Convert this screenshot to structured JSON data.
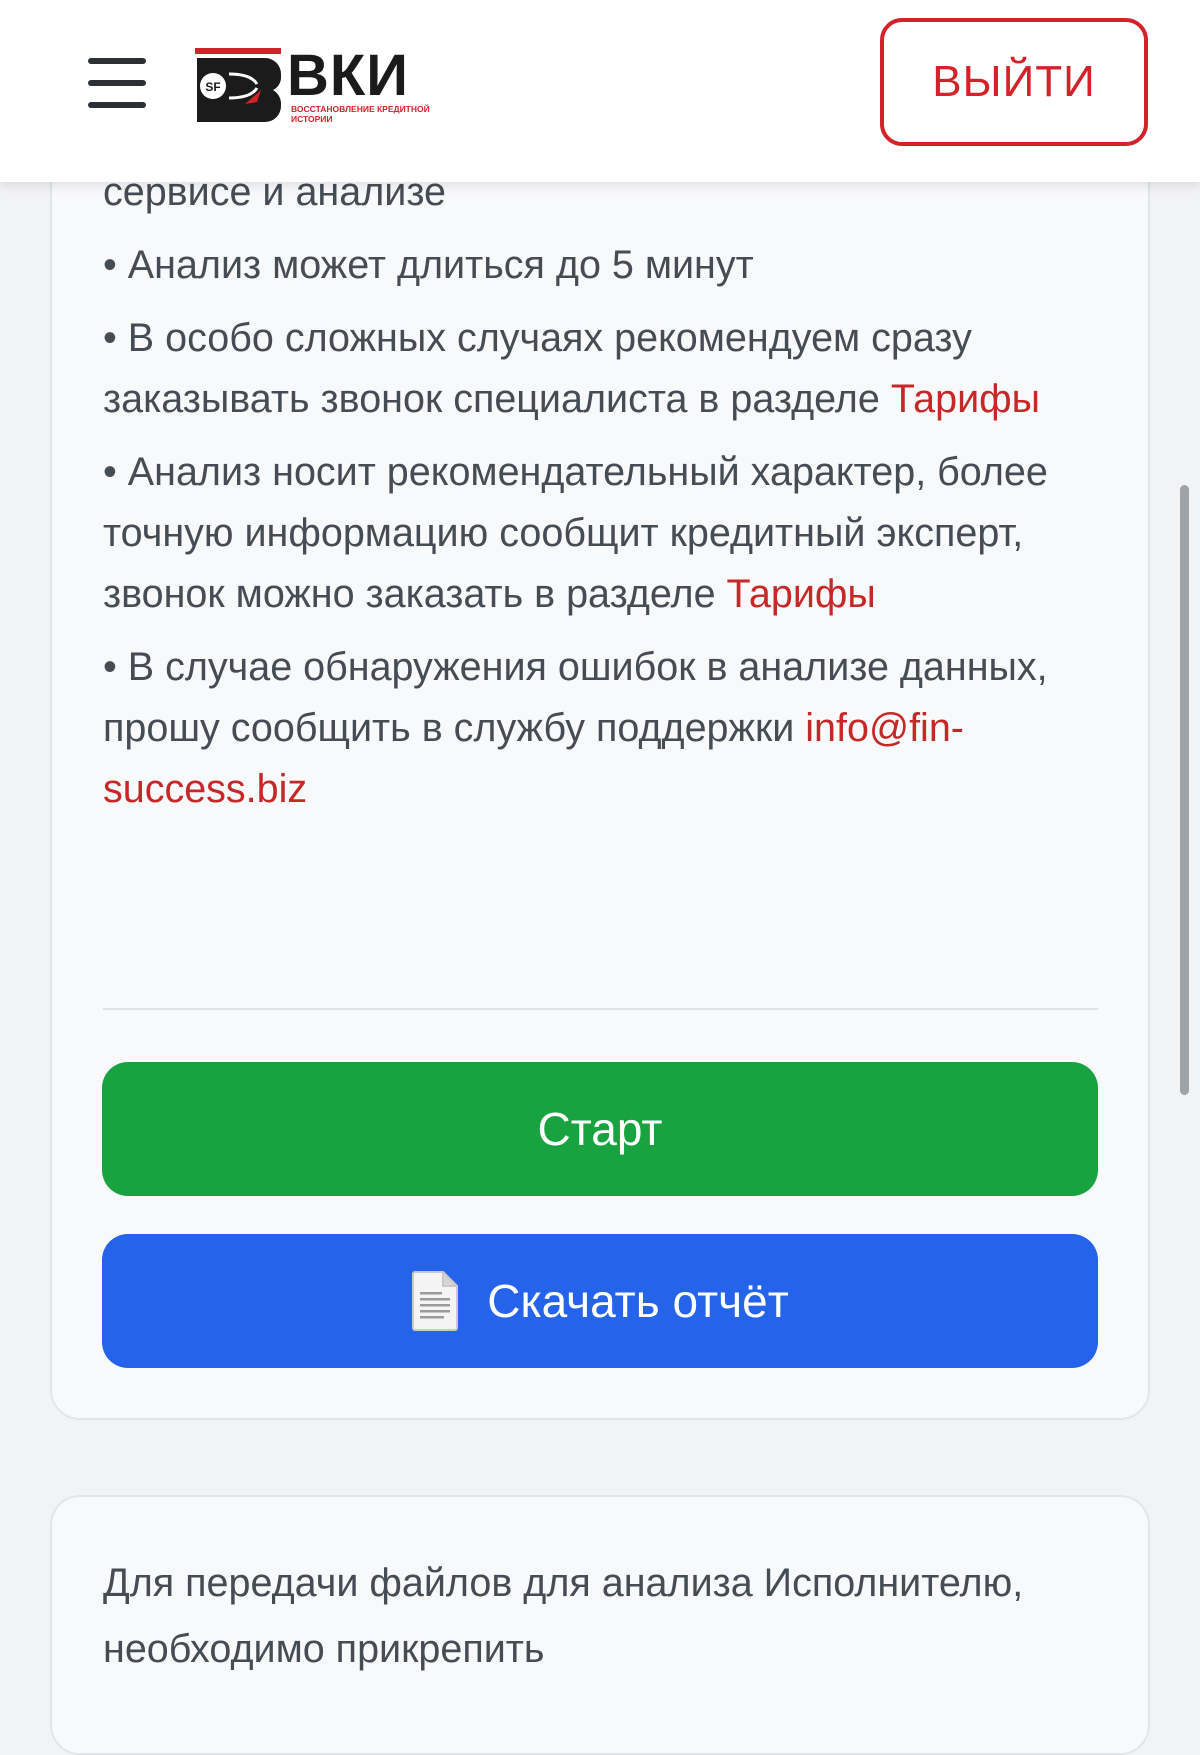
{
  "header": {
    "logo_text": "ВКИ",
    "logo_badge": "SF",
    "logo_subtitle": "ВОССТАНОВЛЕНИЕ КРЕДИТНОЙ ИСТОРИИ",
    "logout_label": "ВЫЙТИ"
  },
  "card1": {
    "fragment": "сервисе и анализе",
    "bullet1": "• Анализ может длиться до 5 минут",
    "bullet2_text": "• В особо сложных случаях рекомендуем сразу заказывать звонок специалиста в разделе",
    "bullet2_link": "Тарифы",
    "bullet3_text": "• Анализ носит рекомендательный характер, более точную информацию сообщит кредитный эксперт, звонок можно заказать в разделе",
    "bullet3_link": "Тарифы",
    "bullet4_text": "• В случае обнаружения ошибок в анализе данных, прошу сообщить в службу поддержки",
    "bullet4_email": "info@fin-success.biz",
    "start_label": "Старт",
    "download_label": "Скачать отчёт"
  },
  "card2": {
    "text": "Для передачи файлов для анализа Исполнителю, необходимо прикрепить"
  },
  "colors": {
    "accent_red": "#c62828",
    "start_green": "#19a340",
    "download_blue": "#2563eb"
  }
}
